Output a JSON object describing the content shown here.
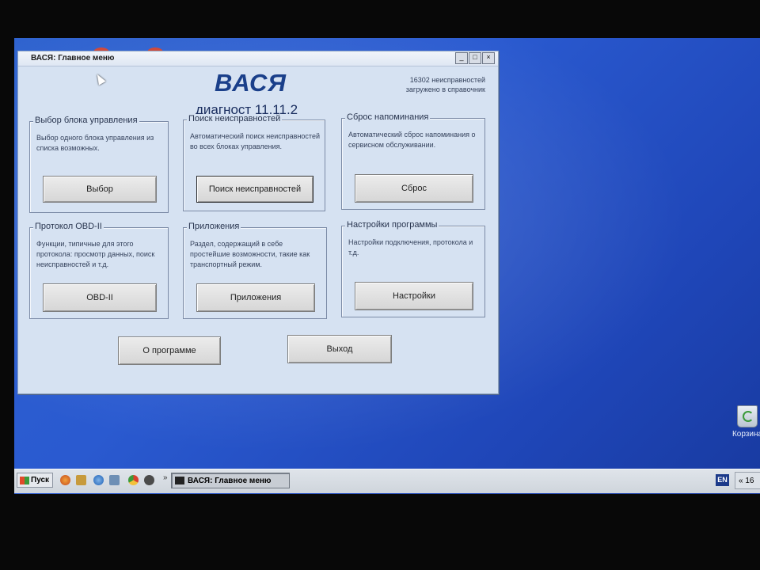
{
  "window": {
    "title": "ВАСЯ: Главное меню",
    "controls": {
      "minimize": "_",
      "maximize": "□",
      "close": "×"
    }
  },
  "header": {
    "app_name": "ВАСЯ",
    "subtitle": "диагност 11.11.2",
    "faults_count_line": "16302 неисправностей",
    "faults_loaded_line": "загружено в справочник"
  },
  "groups": [
    {
      "title": "Выбор блока управления",
      "desc": "Выбор одного блока управления из списка возможных.",
      "button": "Выбор"
    },
    {
      "title": "Поиск неисправностей",
      "desc": "Автоматический поиск неисправностей во всех блоках управления.",
      "button": "Поиск неисправностей"
    },
    {
      "title": "Сброс напоминания",
      "desc": "Автоматический сброс напоминания о сервисном обслуживании.",
      "button": "Сброс"
    },
    {
      "title": "Протокол OBD-II",
      "desc": "Функции, типичные для этого протокола: просмотр данных, поиск неисправностей и т.д.",
      "button": "OBD-II"
    },
    {
      "title": "Приложения",
      "desc": "Раздел, содержащий в себе простейшие возможности, такие как транспортный режим.",
      "button": "Приложения"
    },
    {
      "title": "Настройки программы",
      "desc": "Настройки подключения, протокола и т.д.",
      "button": "Настройки"
    }
  ],
  "bottom": {
    "about": "О программе",
    "exit": "Выход"
  },
  "taskbar": {
    "start": "Пуск",
    "task_label": "ВАСЯ: Главное меню",
    "lang": "EN",
    "clock": "« 16"
  },
  "desktop": {
    "recycle_bin": "Корзина"
  },
  "icons": {
    "start": "windows-flag-icon",
    "quick_launch": [
      "firefox-icon",
      "tools-icon",
      "internet-explorer-icon",
      "network-icon",
      "chrome-icon",
      "media-player-icon"
    ],
    "task": "app-window-icon",
    "recycle": "recycle-bin-icon"
  }
}
